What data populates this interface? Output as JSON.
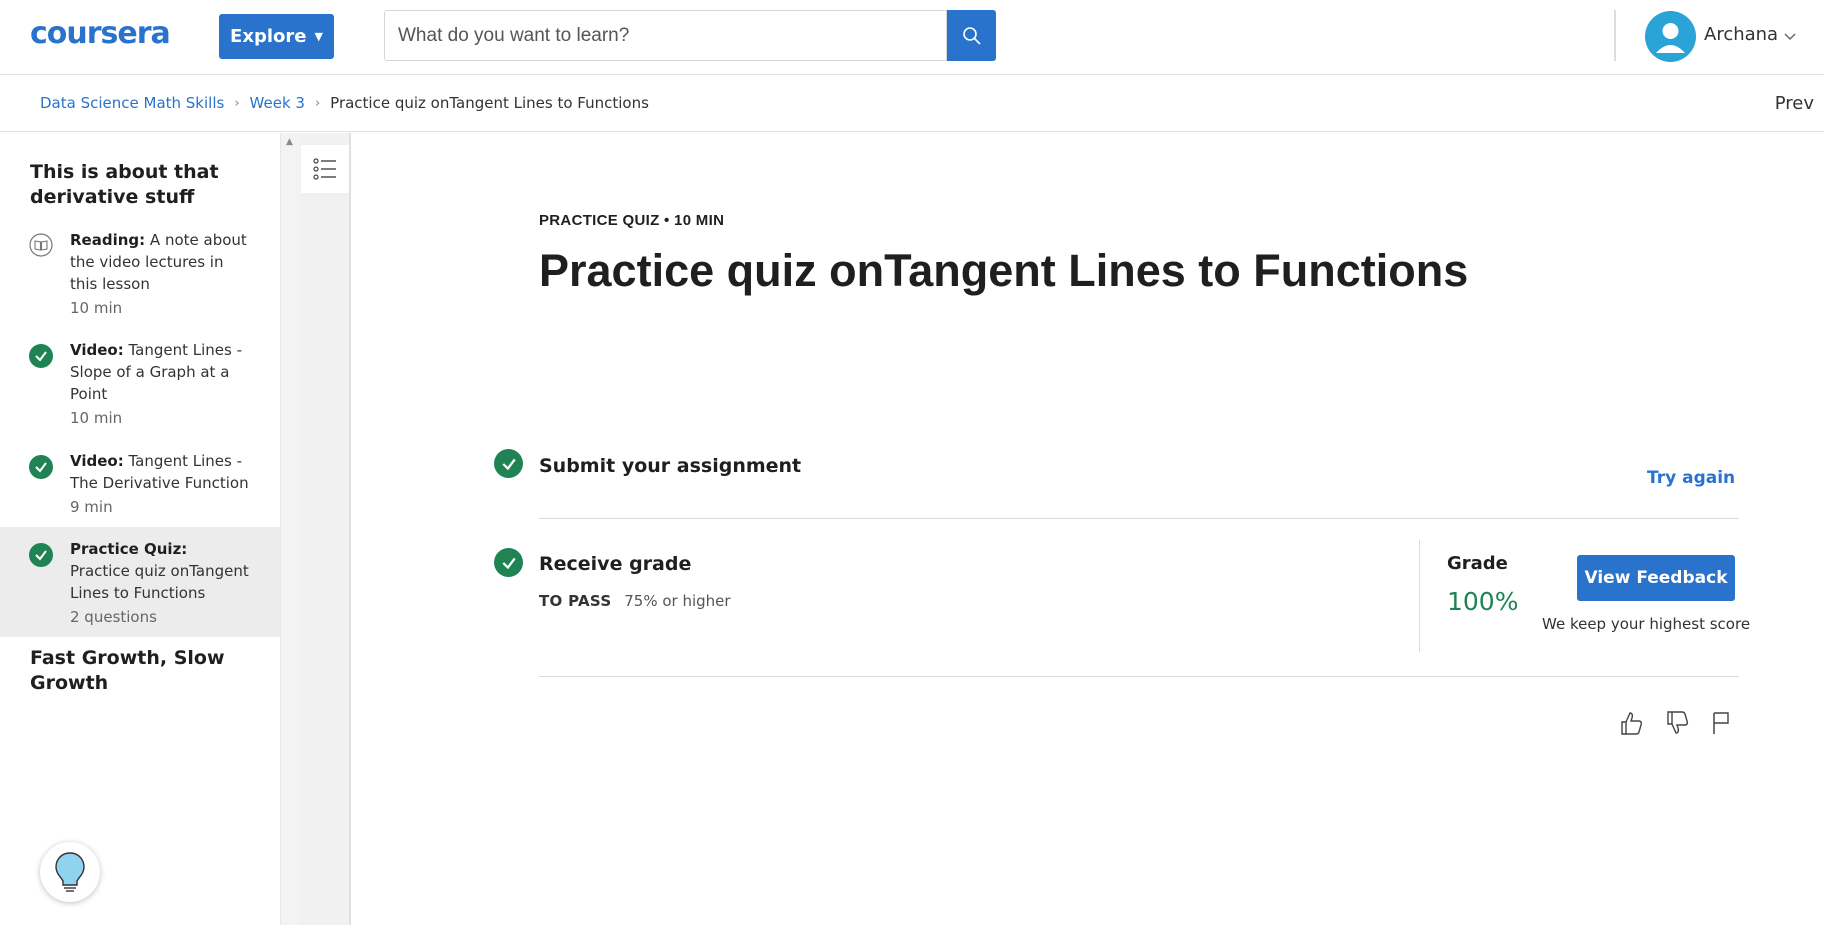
{
  "header": {
    "logo_text": "coursera",
    "explore_label": "Explore",
    "search_placeholder": "What do you want to learn?",
    "user_name": "Archana"
  },
  "breadcrumbs": {
    "items": [
      "Data Science Math Skills",
      "Week 3"
    ],
    "current": "Practice quiz onTangent Lines to Functions",
    "prev_label": "Prev"
  },
  "sidebar": {
    "section_1_title": "This is about that derivative stuff",
    "items": [
      {
        "type": "Reading:",
        "title": "A note about the video lectures in this lesson",
        "meta": "10 min",
        "icon": "book-icon",
        "completed": false
      },
      {
        "type": "Video:",
        "title": "Tangent Lines - Slope of a Graph at a Point",
        "meta": "10 min",
        "icon": "check-icon",
        "completed": true
      },
      {
        "type": "Video:",
        "title": "Tangent Lines - The Derivative Function",
        "meta": "9 min",
        "icon": "check-icon",
        "completed": true
      },
      {
        "type": "Practice Quiz:",
        "title": "Practice quiz onTangent Lines to Functions",
        "meta": "2 questions",
        "icon": "check-icon",
        "completed": true,
        "active": true
      }
    ],
    "section_2_title": "Fast Growth, Slow Growth"
  },
  "main": {
    "kicker": "PRACTICE QUIZ • 10 MIN",
    "title": "Practice quiz onTangent Lines to Functions",
    "submit_title": "Submit your assignment",
    "try_again_label": "Try again",
    "receive_title": "Receive grade",
    "to_pass_label": "TO PASS",
    "to_pass_value": "75% or higher",
    "grade_label": "Grade",
    "grade_value": "100%",
    "view_feedback_label": "View Feedback",
    "keep_note": "We keep your highest score"
  },
  "colors": {
    "brand_blue": "#2a73cc",
    "success_green": "#1f8354"
  }
}
